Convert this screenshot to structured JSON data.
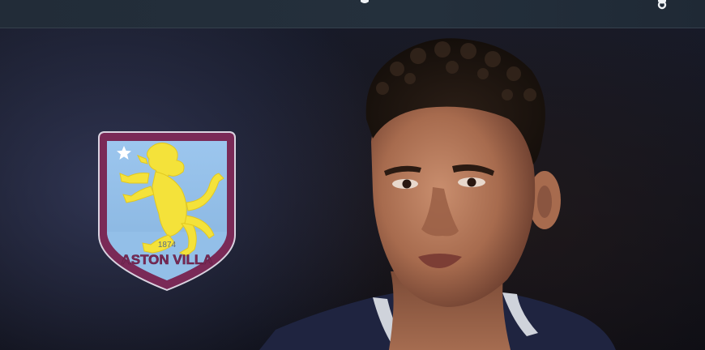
{
  "header": {
    "title": ""
  },
  "crest": {
    "founded": "1874",
    "club_name": "ASTON VILLA",
    "colors": {
      "claret": "#7a2a57",
      "sky_blue": "#93bfe8",
      "gold": "#f4e23a",
      "outline": "#d9d3e0"
    },
    "icon": "lion-rampant-icon",
    "star_icon": "star-icon"
  },
  "photo": {
    "subject": "player-portrait",
    "background_color": "#11131d"
  }
}
